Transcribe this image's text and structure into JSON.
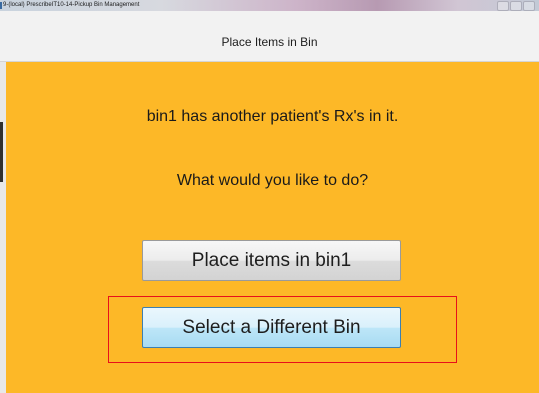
{
  "window": {
    "title": "9-(local) PrescribeIT10-14-Pickup Bin Management"
  },
  "header": {
    "title": "Place Items in Bin"
  },
  "main": {
    "message_line1": "bin1 has another patient's Rx's in it.",
    "message_line2": "What would you like to do?",
    "place_button_label": "Place items in bin1",
    "select_button_label": "Select a Different Bin"
  },
  "colors": {
    "background_accent": "#fdb827",
    "highlight_box": "#e8101a",
    "select_button": "#bde6f8"
  }
}
